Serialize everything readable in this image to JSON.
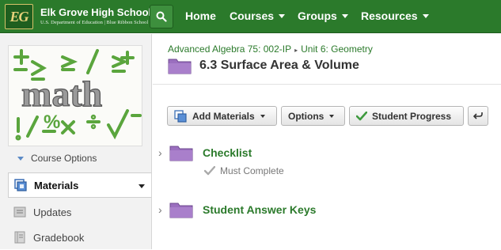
{
  "header": {
    "logo_text": "EG",
    "school_name": "Elk Grove High School",
    "school_subtitle": "U.S. Department of Education | Blue Ribbon School",
    "nav": [
      {
        "label": "Home",
        "has_dropdown": false
      },
      {
        "label": "Courses",
        "has_dropdown": true
      },
      {
        "label": "Groups",
        "has_dropdown": true
      },
      {
        "label": "Resources",
        "has_dropdown": true
      }
    ],
    "accent_color": "#2b7a2b"
  },
  "sidebar": {
    "course_image_text": "math",
    "course_options_label": "Course Options",
    "items": [
      {
        "label": "Materials",
        "active": true,
        "icon": "materials-icon"
      },
      {
        "label": "Updates",
        "active": false,
        "icon": "updates-icon"
      },
      {
        "label": "Gradebook",
        "active": false,
        "icon": "gradebook-icon"
      }
    ]
  },
  "main": {
    "breadcrumb": [
      "Advanced Algebra 75: 002-IP",
      "Unit 6: Geometry"
    ],
    "title": "6.3 Surface Area & Volume",
    "toolbar": {
      "add_materials": "Add Materials",
      "options": "Options",
      "student_progress": "Student Progress"
    },
    "folders": [
      {
        "title": "Checklist",
        "requirement": "Must Complete"
      },
      {
        "title": "Student Answer Keys",
        "requirement": ""
      }
    ],
    "folder_color": "#9b6fbf"
  }
}
